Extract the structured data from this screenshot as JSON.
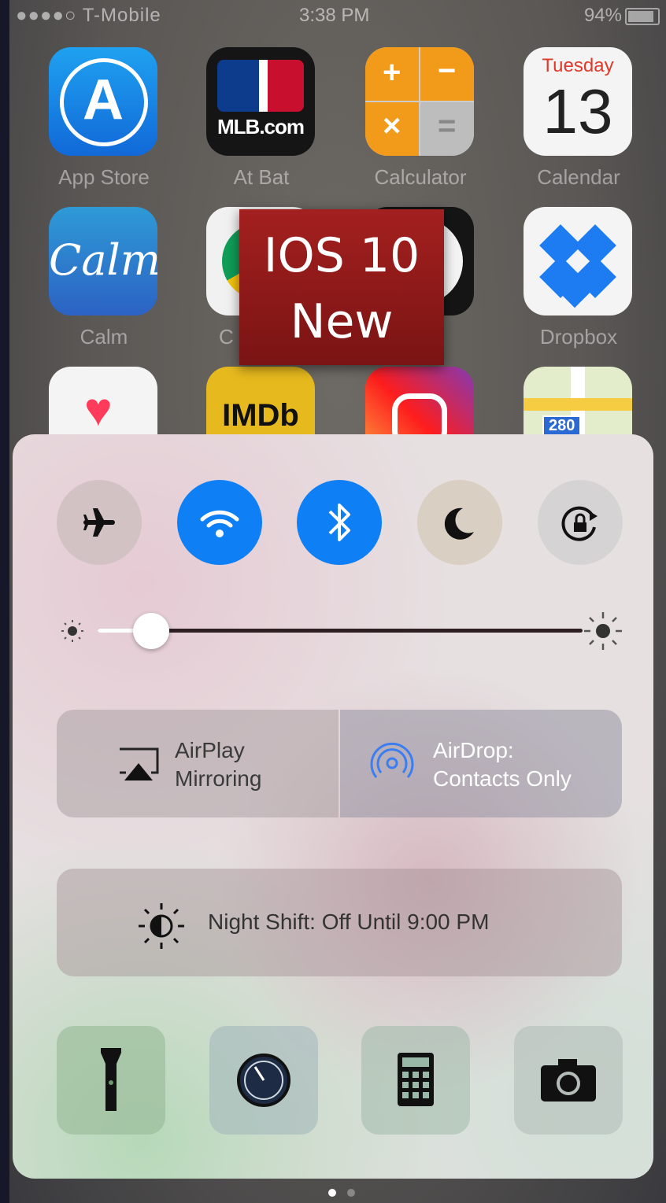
{
  "status_bar": {
    "carrier": "●●●●○ T-Mobile",
    "time": "3:38 PM",
    "battery": "94%"
  },
  "home_apps": {
    "app_store": "App Store",
    "at_bat": "At Bat",
    "calculator": "Calculator",
    "calendar": "Calendar",
    "calendar_day": "Tuesday",
    "calendar_date": "13",
    "calm": "Calm",
    "calm_logo": "Calm",
    "chrome_partial": "C",
    "dropbox": "Dropbox",
    "at_bat_logo": "MLB.com",
    "imdb_logo": "IMDb",
    "maps_sign": "280"
  },
  "overlay": {
    "line1": "IOS 10",
    "line2": "New"
  },
  "control_center": {
    "toggles": [
      {
        "name": "airplane-mode",
        "icon": "airplane-icon",
        "active": false
      },
      {
        "name": "wifi",
        "icon": "wifi-icon",
        "active": true
      },
      {
        "name": "bluetooth",
        "icon": "bluetooth-icon",
        "active": true
      },
      {
        "name": "do-not-disturb",
        "icon": "moon-icon",
        "active": false
      },
      {
        "name": "rotation-lock",
        "icon": "rotation-lock-icon",
        "active": false
      }
    ],
    "brightness": 0.11,
    "airplay": {
      "line1": "AirPlay",
      "line2": "Mirroring"
    },
    "airdrop": {
      "line1": "AirDrop:",
      "line2": "Contacts Only"
    },
    "night_shift": "Night Shift: Off Until 9:00 PM",
    "shortcuts": [
      "flashlight-icon",
      "timer-icon",
      "calculator-icon",
      "camera-icon"
    ],
    "colors": {
      "active_toggle": "#0f7ff5"
    }
  },
  "page_indicator": {
    "pages": 2,
    "current": 1
  }
}
